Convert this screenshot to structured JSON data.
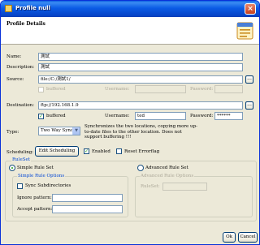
{
  "window": {
    "title": "Profile null"
  },
  "header": {
    "title": "Profile Details"
  },
  "form": {
    "name": {
      "label": "Name:",
      "value": "測試"
    },
    "description": {
      "label": "Description:",
      "value": "測試"
    },
    "source": {
      "label": "Source:",
      "value": "file:/C:/測試1/",
      "browse": "...",
      "buffered_label": "buffered",
      "username_label": "Username:",
      "username_value": "",
      "password_label": "Password:",
      "password_value": ""
    },
    "destination": {
      "label": "Destination:",
      "value": "ftp://192.168.1.9",
      "browse": "...",
      "buffered_label": "buffered",
      "username_label": "Username:",
      "username_value": "ted",
      "password_label": "Password:",
      "password_value": "******"
    },
    "type": {
      "label": "Type:",
      "selected": "Two Way Sync",
      "note": "Synchronizes the two locations, copying more up-to-date files to the other location. Does not support buffering !!!"
    },
    "scheduling": {
      "label": "Scheduling:",
      "edit_button": "Edit Scheduling",
      "enabled_label": "Enabled",
      "reset_label": "Reset Errorflag"
    }
  },
  "ruleset": {
    "legend": "RuleSet",
    "simple_radio": "Simple Rule Set",
    "advanced_radio": "Advanced Rule Set",
    "simple_options": {
      "legend": "Simple Rule Options",
      "sync_subdirs": "Sync Subdirectories",
      "ignore_label": "Ignore pattern:",
      "ignore_value": "",
      "accept_label": "Accept pattern:",
      "accept_value": ""
    },
    "advanced_options": {
      "legend": "Advanced Rule Options",
      "ruleset_label": "RuleSet:",
      "ruleset_value": ""
    }
  },
  "footer": {
    "ok": "Ok",
    "cancel": "Cancel"
  },
  "colors": {
    "titlebar": "#0a5ddf",
    "dialog_bg": "#ece9d8",
    "check_mark": "#21a121",
    "group_title": "#0046d5"
  }
}
